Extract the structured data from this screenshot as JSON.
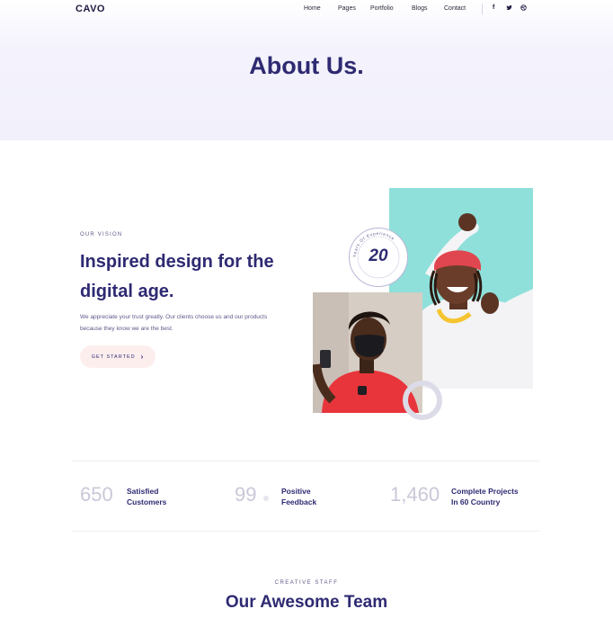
{
  "nav": {
    "logo": "CAVO",
    "items": [
      "Home",
      "Pages",
      "Portfolio",
      "Blogs",
      "Contact"
    ],
    "social": [
      "facebook-icon",
      "twitter-icon",
      "dribbble-icon"
    ]
  },
  "hero": {
    "title": "About Us."
  },
  "vision": {
    "eyebrow": "OUR VISION",
    "headline": "Inspired design for the digital age.",
    "body": "We appreciate your trust greatly. Our clients choose us and our products because they know we are the best.",
    "cta_label": "GET STARTED",
    "badge_number": "20",
    "badge_text": "Years Of Experience"
  },
  "stats": [
    {
      "number": "650",
      "label_line1": "Satisfied",
      "label_line2": "Customers"
    },
    {
      "number": "99",
      "label_line1": "Positive",
      "label_line2": "Feedback"
    },
    {
      "number": "1,460",
      "label_line1": "Complete Projects",
      "label_line2": "In 60 Country"
    }
  ],
  "team": {
    "eyebrow": "CREATIVE STAFF",
    "title": "Our Awesome Team"
  },
  "colors": {
    "primary": "#2e2a72",
    "accent_bg": "#fdeeee",
    "teal": "#8ee0db"
  }
}
